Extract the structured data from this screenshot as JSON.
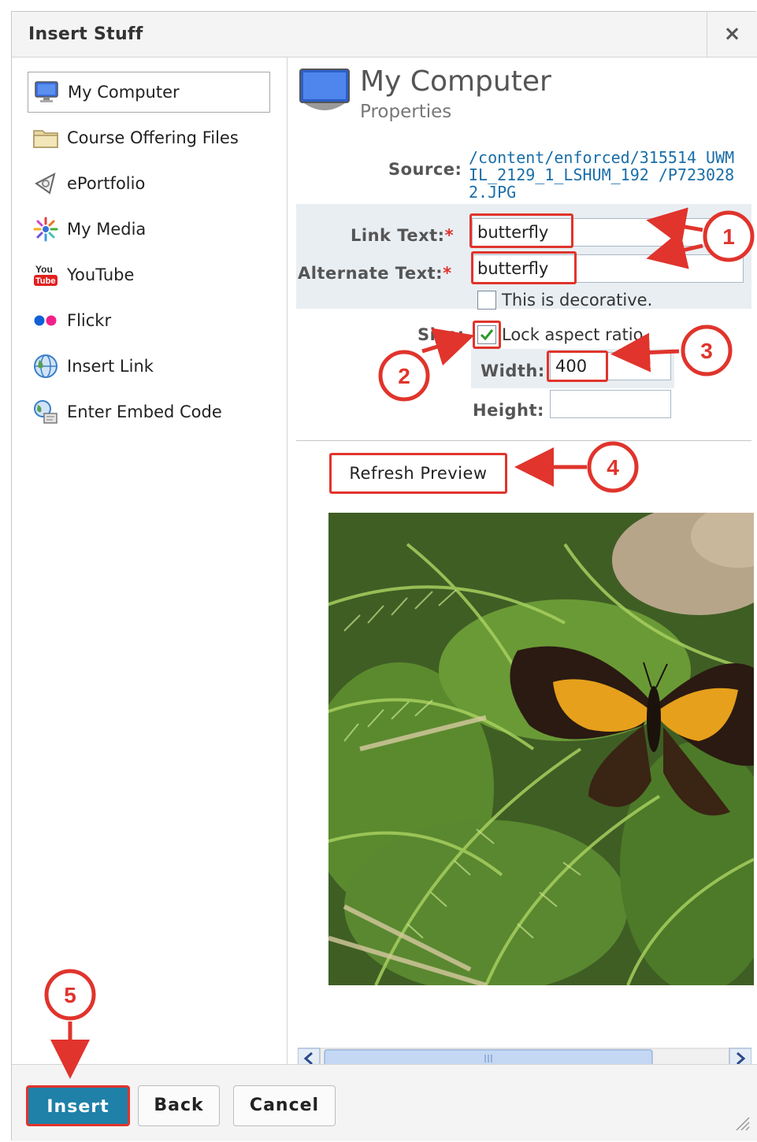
{
  "dialog": {
    "title": "Insert Stuff",
    "close_symbol": "×"
  },
  "sidebar": {
    "items": [
      {
        "label": "My Computer",
        "icon": "monitor-icon",
        "selected": true
      },
      {
        "label": "Course Offering Files",
        "icon": "folder-icon",
        "selected": false
      },
      {
        "label": "ePortfolio",
        "icon": "eportfolio-icon",
        "selected": false
      },
      {
        "label": "My Media",
        "icon": "media-icon",
        "selected": false
      },
      {
        "label": "YouTube",
        "icon": "youtube-icon",
        "selected": false
      },
      {
        "label": "Flickr",
        "icon": "flickr-icon",
        "selected": false
      },
      {
        "label": "Insert Link",
        "icon": "globe-icon",
        "selected": false
      },
      {
        "label": "Enter Embed Code",
        "icon": "embed-code-icon",
        "selected": false
      }
    ]
  },
  "properties": {
    "header_title": "My Computer",
    "header_subtitle": "Properties",
    "source_label": "Source:",
    "source_value": "/content/enforced/315514 UWMIL_2129_1_LSHUM_192 /P7230282.JPG",
    "link_text_label": "Link Text:",
    "link_text_value": "butterfly",
    "alt_text_label": "Alternate Text:",
    "alt_text_value": "butterfly",
    "required_mark": "*",
    "decorative_label": "This is decorative.",
    "decorative_checked": false,
    "size_label": "Size:",
    "lock_label": "Lock aspect ratio",
    "lock_checked": true,
    "width_label": "Width:",
    "width_value": "400",
    "height_label": "Height:",
    "height_value": "",
    "refresh_label": "Refresh Preview"
  },
  "footer": {
    "insert_label": "Insert",
    "back_label": "Back",
    "cancel_label": "Cancel"
  },
  "annotations": {
    "badges": [
      "1",
      "2",
      "3",
      "4",
      "5"
    ],
    "color": "#e0342c"
  },
  "colors": {
    "accent": "#1f80a8",
    "link": "#1a6ea8",
    "highlight": "#e0342c"
  }
}
